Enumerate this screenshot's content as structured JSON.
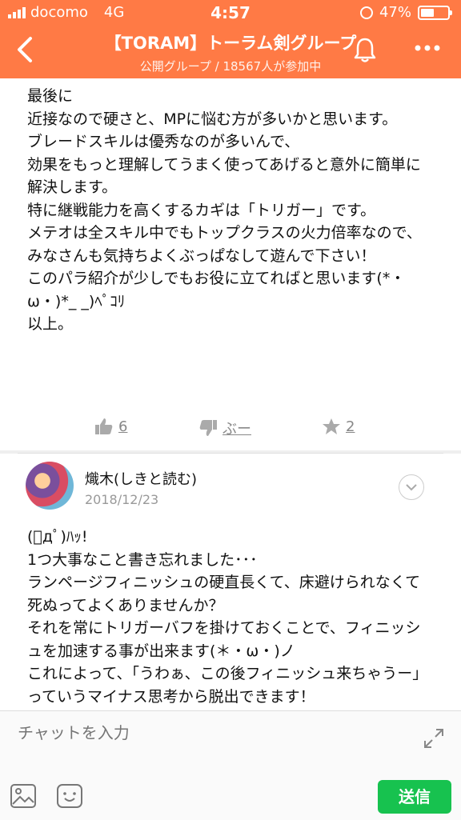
{
  "status_bar": {
    "carrier": "docomo",
    "network": "4G",
    "time": "4:57",
    "battery": "47%"
  },
  "header": {
    "title": "【TORAM】トーラム剣グループ",
    "subtitle": "公開グループ / 18567人が参加中",
    "back_icon": "chevron-left-icon",
    "bell_icon": "bell-icon",
    "more_icon": "more-dots-icon"
  },
  "post": {
    "paragraphs": [
      "最後に",
      "",
      "近接なので硬さと、MPに悩む方が多いかと思います。",
      "ブレードスキルは優秀なのが多いんで、",
      "効果をもっと理解してうまく使ってあげると意外に簡単に解決します。",
      "特に継戦能力を高くするカギは「トリガー」です。",
      "",
      "メテオは全スキル中でもトップクラスの火力倍率なので、みなさんも気持ちよくぶっぱなして遊んで下さい！",
      "このパラ紹介が少しでもお役に立てればと思います(*・ω・)*_ _)ﾍﾟｺﾘ",
      "",
      "以上。"
    ],
    "likes": "6",
    "dislike_label": "ぶー",
    "stars": "2"
  },
  "comment": {
    "author": "熾木(しきと読む)",
    "date": "2018/12/23",
    "paragraphs": [
      "(ﾟдﾟ)ﾊｯ!",
      "1つ大事なこと書き忘れました･･･",
      "",
      "ランページフィニッシュの硬直長くて、床避けられなくて死ぬってよくありませんか？",
      "それを常にトリガーバフを掛けておくことで、フィニッシュを加速する事が出来ます(＊・ω・)ノ",
      "これによって、「うわぁ、この後フィニッシュ来ちゃうー」っていうマイナス思考から脱出できます！"
    ]
  },
  "composer": {
    "placeholder": "チャットを入力",
    "send_label": "送信"
  },
  "colors": {
    "header": "#ff7a45",
    "send": "#17c24f"
  }
}
